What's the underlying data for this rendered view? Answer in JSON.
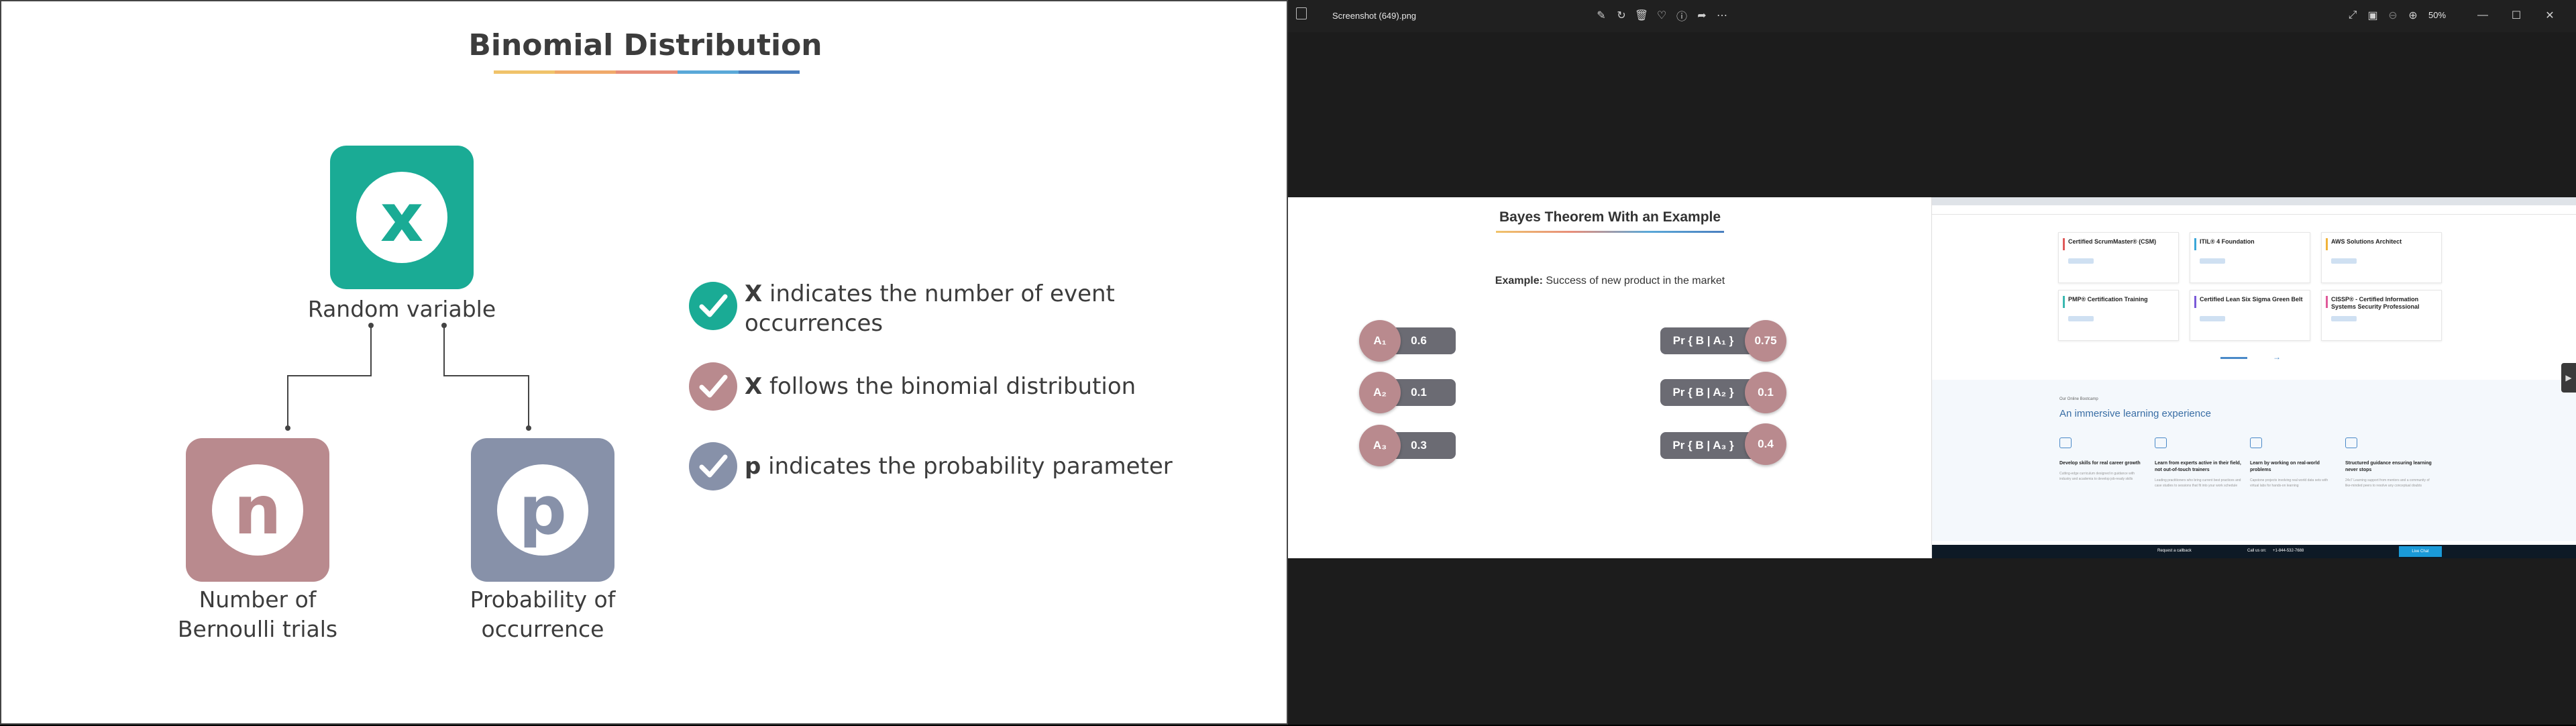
{
  "slide": {
    "title": "Binomial Distribution",
    "underline_colors": [
      "#f0c36a",
      "#f0a96a",
      "#e78e7a",
      "#5aa8d8",
      "#4a7fbf"
    ],
    "x_tile": {
      "letter": "x",
      "color": "#1aab95",
      "caption": "Random variable"
    },
    "n_tile": {
      "letter": "n",
      "color": "#b98a8e",
      "caption_line1": "Number of",
      "caption_line2": "Bernoulli trials"
    },
    "p_tile": {
      "letter": "p",
      "color": "#8791a9",
      "caption_line1": "Probability of",
      "caption_line2": "occurrence"
    },
    "bullets": [
      {
        "bold": "X",
        "text": " indicates the number of event occurrences",
        "color": "#1aab95"
      },
      {
        "bold": "X",
        "text": " follows the binomial distribution",
        "color": "#b98a8e"
      },
      {
        "bold": "p",
        "text": " indicates the probability parameter",
        "color": "#8791a9"
      }
    ]
  },
  "viewer": {
    "filename": "Screenshot (649).png",
    "zoom": "50%",
    "toolbar_icons": [
      "edit-icon",
      "rotate-icon",
      "delete-icon",
      "favorite-icon",
      "info-icon",
      "share-icon",
      "more-icon"
    ],
    "right_icons": [
      "fullscreen-icon",
      "slideshow-icon",
      "zoom-out-icon",
      "zoom-in-icon"
    ],
    "window_controls": [
      "minimize-icon",
      "maximize-icon",
      "close-icon"
    ]
  },
  "bayes": {
    "title": "Bayes Theorem With an Example",
    "example_label": "Example:",
    "example_text": " Success of new product in the market",
    "rows": [
      {
        "a": "A₁",
        "a_val": "0.6",
        "pr": "Pr { B | A₁ }",
        "pr_val": "0.75"
      },
      {
        "a": "A₂",
        "a_val": "0.1",
        "pr": "Pr { B | A₂ }",
        "pr_val": "0.1"
      },
      {
        "a": "A₃",
        "a_val": "0.3",
        "pr": "Pr { B | A₃ }",
        "pr_val": "0.4"
      }
    ]
  },
  "web": {
    "cards": [
      {
        "title": "Certified ScrumMaster® (CSM)",
        "color": "#e05a5a"
      },
      {
        "title": "ITIL® 4 Foundation",
        "color": "#3aa6d8"
      },
      {
        "title": "AWS Solutions Architect",
        "color": "#f0b33a"
      },
      {
        "title": "PMP® Certification Training",
        "color": "#3ab8b0"
      },
      {
        "title": "Certified Lean Six Sigma Green Belt",
        "color": "#7a5ad8"
      },
      {
        "title": "CISSP® - Certified Information Systems Security Professional",
        "color": "#e05a9a"
      }
    ],
    "section_kicker": "Our Online Bootcamp",
    "section_title": "An immersive learning experience",
    "features": [
      {
        "title": "Develop skills for real career growth",
        "desc": "Cutting-edge curriculum designed in guidance with industry and academia to develop job-ready skills"
      },
      {
        "title": "Learn from experts active in their field, not out-of-touch trainers",
        "desc": "Leading practitioners who bring current best practices and case studies to sessions that fit into your work schedule"
      },
      {
        "title": "Learn by working on real-world problems",
        "desc": "Capstone projects involving real world data sets with virtual labs for hands-on learning"
      },
      {
        "title": "Structured guidance ensuring learning never stops",
        "desc": "24x7 Learning support from mentors and a community of like-minded peers to resolve any conceptual doubts"
      }
    ],
    "footer": {
      "callback": "Request a callback",
      "call": "Call us on:",
      "phone": "+1-844-532-7688",
      "chat": "Live Chat"
    }
  }
}
